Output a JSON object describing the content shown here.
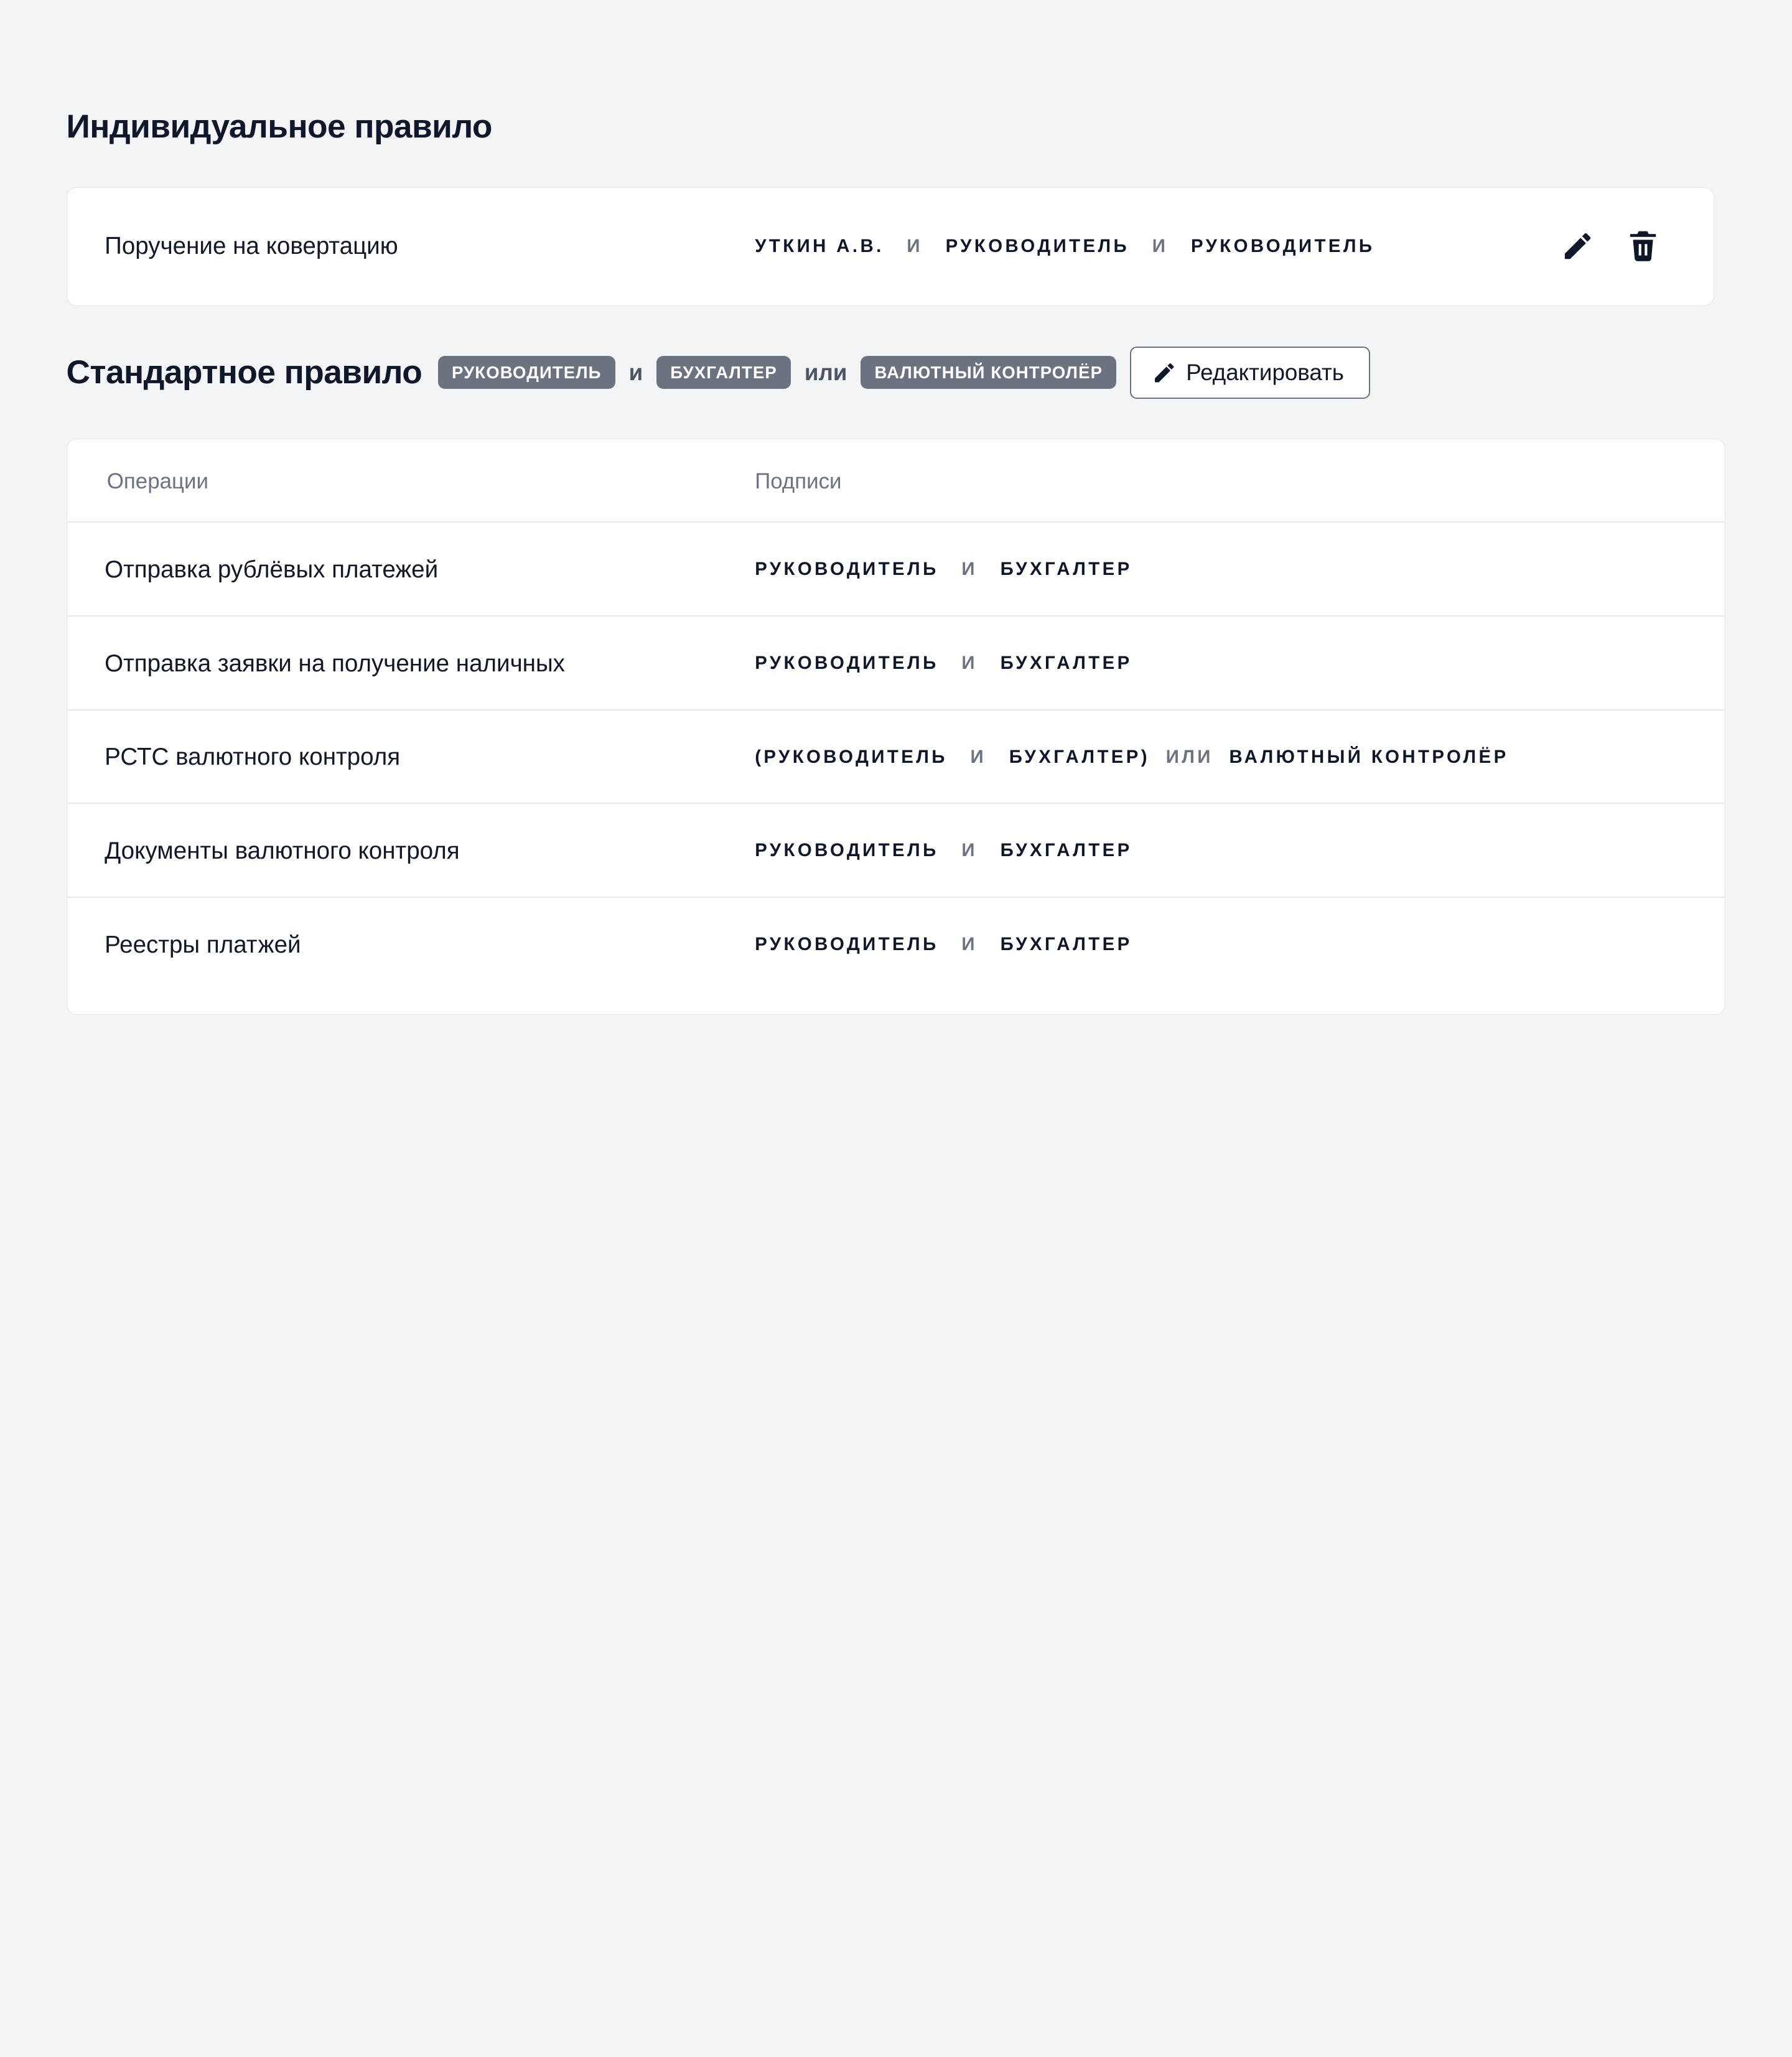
{
  "individual": {
    "title": "Индивидуальное правило",
    "operation": "Поручение на ковертацию",
    "signers": [
      "УТКИН А.В.",
      "РУКОВОДИТЕЛЬ",
      "РУКОВОДИТЕЛЬ"
    ],
    "conjunction": "И",
    "edit_icon": "pencil-icon",
    "delete_icon": "trash-icon"
  },
  "standard": {
    "title": "Стандартное правило",
    "badges": [
      "РУКОВОДИТЕЛЬ",
      "БУХГАЛТЕР",
      "ВАЛЮТНЫЙ КОНТРОЛЁР"
    ],
    "conj_and": "и",
    "conj_or": "или",
    "edit_button_label": "Редактировать",
    "edit_button_icon": "pencil-icon"
  },
  "table": {
    "headers": {
      "operations": "Операции",
      "signatures": "Подписи"
    },
    "rows": [
      {
        "operation": "Отправка рублёвых платежей",
        "sig": [
          "РУКОВОДИТЕЛЬ",
          "И",
          "БУХГАЛТЕР"
        ]
      },
      {
        "operation": "Отправка заявки на получение наличных",
        "sig": [
          "РУКОВОДИТЕЛЬ",
          "И",
          "БУХГАЛТЕР"
        ]
      },
      {
        "operation": "РСТС валютного контроля",
        "sig": [
          "(РУКОВОДИТЕЛЬ",
          "И",
          "БУХГАЛТЕР)",
          "ИЛИ",
          "ВАЛЮТНЫЙ КОНТРОЛЁР"
        ]
      },
      {
        "operation": "Документы валютного контроля",
        "sig": [
          "РУКОВОДИТЕЛЬ",
          "И",
          "БУХГАЛТЕР"
        ]
      },
      {
        "operation": "Реестры платжей",
        "sig": [
          "РУКОВОДИТЕЛЬ",
          "И",
          "БУХГАЛТЕР"
        ]
      }
    ]
  },
  "colors": {
    "background": "#f3f4f6",
    "card": "#ffffff",
    "text": "#0f172a",
    "muted": "#6b7280",
    "badge": "#6b7280"
  }
}
